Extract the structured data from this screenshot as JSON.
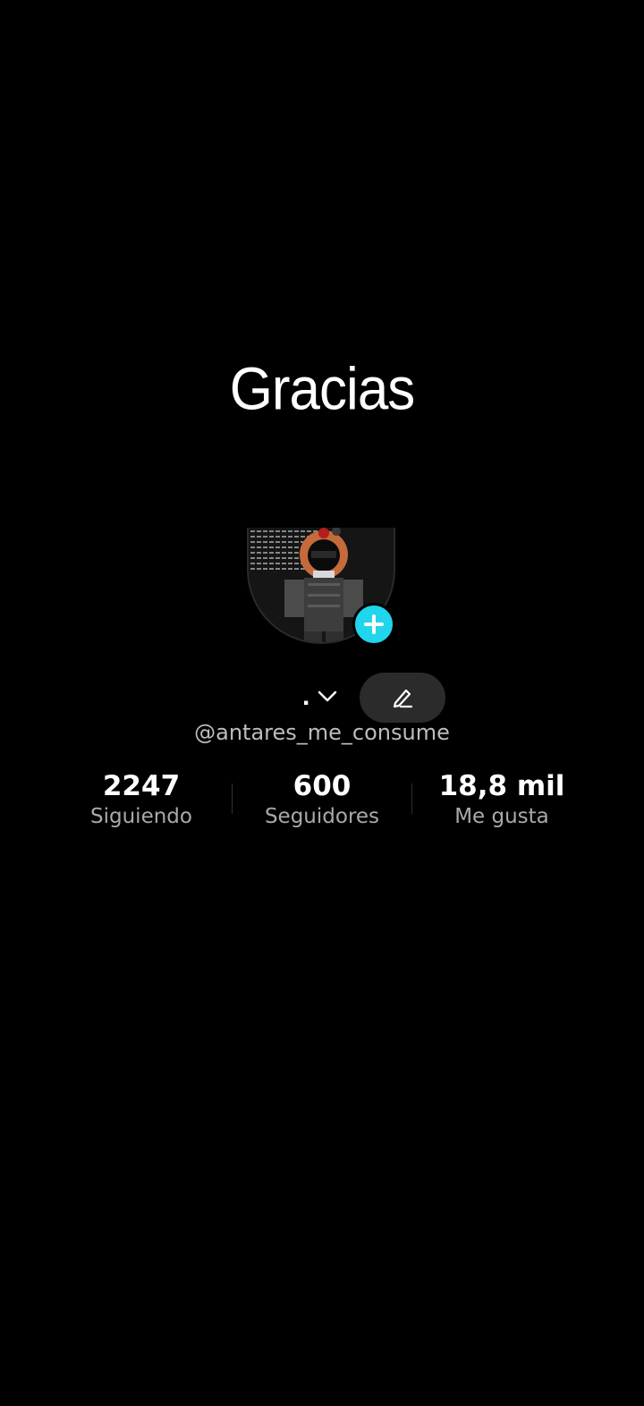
{
  "overlay": {
    "title": "Gracias"
  },
  "profile": {
    "avatar_icon": "roblox-character-avatar",
    "add_badge_icon": "plus-icon",
    "add_badge_color": "#20d5ec",
    "display_name": ".",
    "dropdown_icon": "chevron-down-icon",
    "edit_icon": "pencil-icon",
    "handle": "@antares_me_consume"
  },
  "stats": [
    {
      "value": "2247",
      "label": "Siguiendo"
    },
    {
      "value": "600",
      "label": "Seguidores"
    },
    {
      "value": "18,8 mil",
      "label": "Me gusta"
    }
  ]
}
